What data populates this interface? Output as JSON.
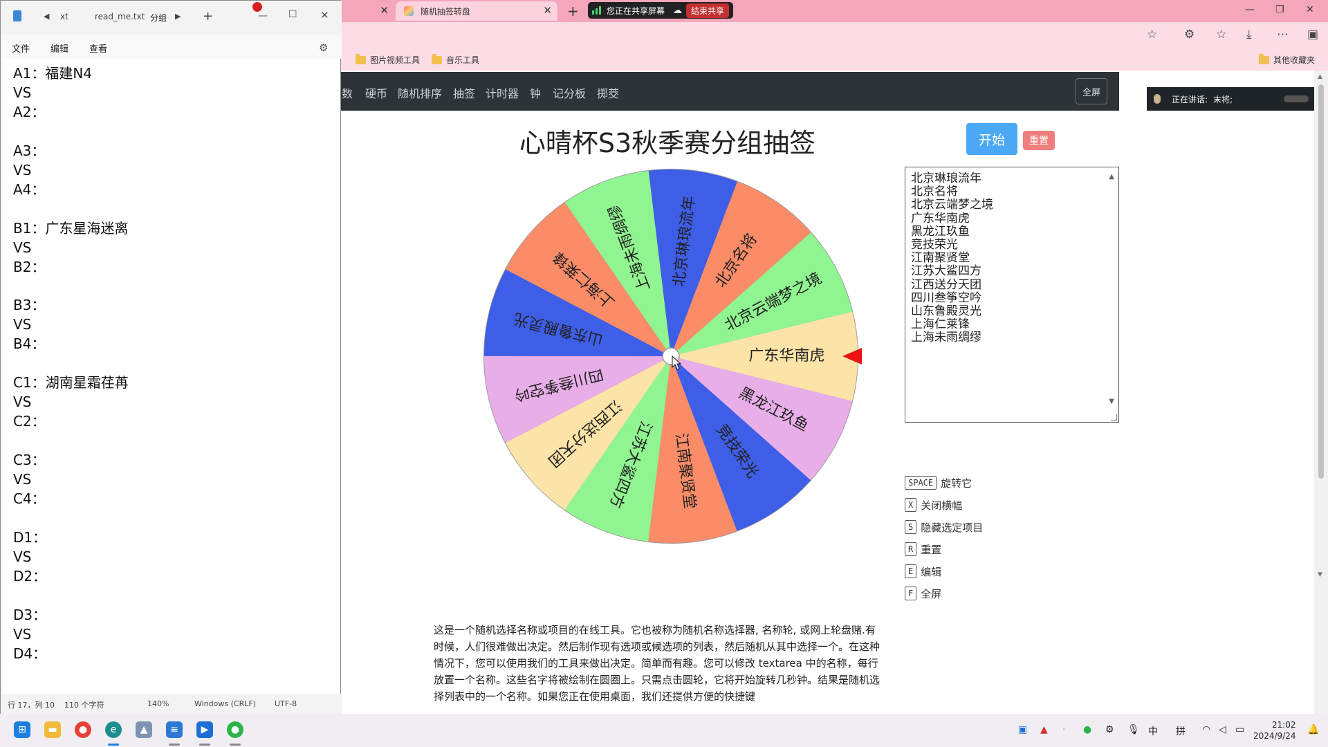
{
  "browser": {
    "tabs": [
      {
        "label": ""
      },
      {
        "label": "随机抽签转盘"
      }
    ],
    "sharing": {
      "label": "您正在共享屏幕",
      "end_label": "结束共享"
    },
    "bookmarks": [
      {
        "label": "图片视频工具"
      },
      {
        "label": "音乐工具"
      }
    ],
    "other_bookmarks": "其他收藏夹"
  },
  "page": {
    "nav_items": [
      "数",
      "硬币",
      "随机排序",
      "抽签",
      "计时器",
      "钟",
      "记分板",
      "掷茭"
    ],
    "fullscreen_label": "全屏",
    "speaking": {
      "label": "正在讲话:",
      "name": "末将;"
    },
    "title": "心晴杯S3秋季赛分组抽签",
    "start_label": "开始",
    "reset_label": "重置",
    "names": [
      "北京琳琅流年",
      "北京名将",
      "北京云端梦之境",
      "广东华南虎",
      "黑龙江玖鱼",
      "竞技荣光",
      "江南聚贤堂",
      "江苏大鲨四方",
      "江西送分天团",
      "四川叁筝空吟",
      "山东鲁殿灵光",
      "上海仁莱锋",
      "上海未雨绸缪"
    ],
    "wheel": {
      "segments": [
        {
          "label": "北京琳琅流年",
          "color": "#3e5ee8"
        },
        {
          "label": "北京名将",
          "color": "#fb8c68"
        },
        {
          "label": "北京云端梦之境",
          "color": "#90f590"
        },
        {
          "label": "广东华南虎",
          "color": "#fce4a8"
        },
        {
          "label": "黑龙江玖鱼",
          "color": "#e8aee8"
        },
        {
          "label": "竞技荣光",
          "color": "#3e5ee8"
        },
        {
          "label": "江南聚贤堂",
          "color": "#fb8c68"
        },
        {
          "label": "江苏大鲨四方",
          "color": "#90f590"
        },
        {
          "label": "江西送分天团",
          "color": "#fce4a8"
        },
        {
          "label": "四川叁筝空吟",
          "color": "#e8aee8"
        },
        {
          "label": "山东鲁殿灵光",
          "color": "#3e5ee8"
        },
        {
          "label": "上海仁莱锋",
          "color": "#fb8c68"
        },
        {
          "label": "上海未雨绸缪",
          "color": "#90f590"
        }
      ],
      "pointer_color": "#ee1111"
    },
    "shortcuts": [
      {
        "key": "SPACE",
        "label": "旋转它"
      },
      {
        "key": "X",
        "label": "关闭横幅"
      },
      {
        "key": "S",
        "label": "隐藏选定项目"
      },
      {
        "key": "R",
        "label": "重置"
      },
      {
        "key": "E",
        "label": "编辑"
      },
      {
        "key": "F",
        "label": "全屏"
      }
    ],
    "description": "这是一个随机选择名称或项目的在线工具。它也被称为随机名称选择器, 名称轮, 或网上轮盘赌.有时候，人们很难做出决定。然后制作现有选项或候选项的列表，然后随机从其中选择一个。在这种情况下，您可以使用我们的工具来做出决定。简单而有趣。您可以修改 textarea 中的名称，每行放置一个名称。这些名字将被绘制在圆圈上。只需点击圆轮，它将开始旋转几秒钟。结果是随机选择列表中的一个名称。如果您正在使用桌面，我们还提供方便的快捷键"
  },
  "notepad": {
    "tabs": [
      "xt",
      "read_me.txt",
      "分组"
    ],
    "menu": [
      "文件",
      "编辑",
      "查看"
    ],
    "content": "A1：福建N4\nVS\nA2：\n\nA3：\nVS\nA4：\n\nB1：广东星海迷离\nVS\nB2：\n\nB3：\nVS\nB4：\n\nC1：湖南星霜荏苒\nVS\nC2：\n\nC3：\nVS\nC4：\n\nD1：\nVS\nD2：\n\nD3：\nVS\nD4：",
    "status": {
      "position": "行 17，列 10",
      "chars": "110 个字符",
      "zoom": "140%",
      "eol": "Windows (CRLF)",
      "encoding": "UTF-8"
    }
  },
  "taskbar": {
    "tray": {
      "ime": "中",
      "ime2": "拼"
    },
    "time": "21:02",
    "date": "2024/9/24"
  }
}
